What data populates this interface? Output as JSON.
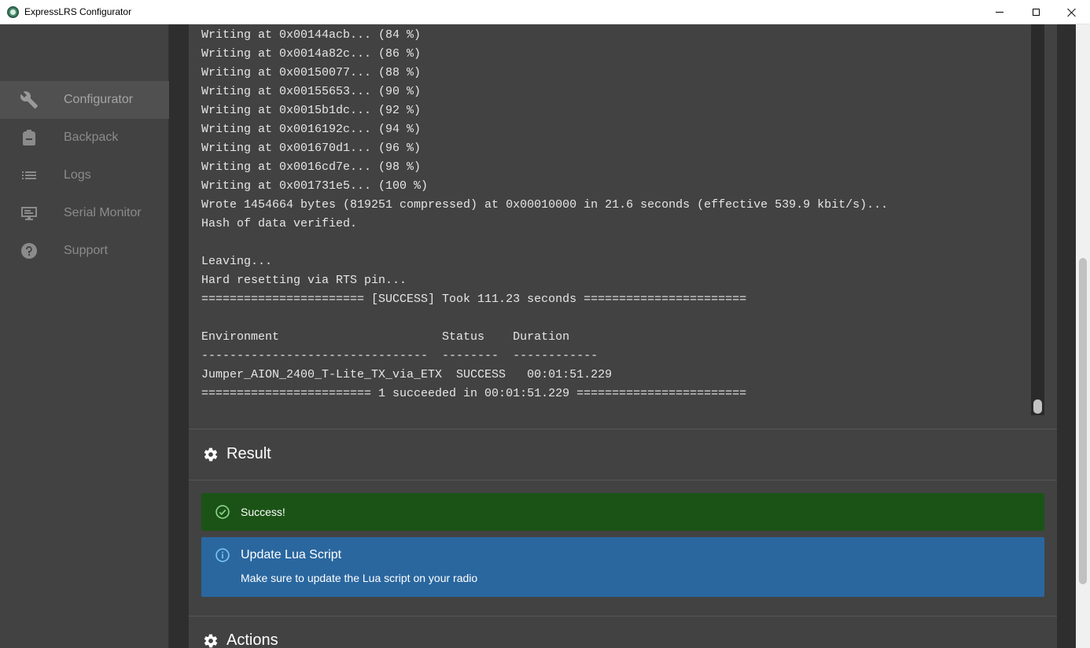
{
  "window": {
    "title": "ExpressLRS Configurator",
    "icon": "expresslrs-logo-icon",
    "controls": [
      "minimize-icon",
      "maximize-icon",
      "close-icon"
    ]
  },
  "sidebar": {
    "active": "Configurator",
    "items": [
      {
        "label": "Configurator",
        "icon": "wrench-icon"
      },
      {
        "label": "Backpack",
        "icon": "backpack-icon"
      },
      {
        "label": "Logs",
        "icon": "list-icon"
      },
      {
        "label": "Serial Monitor",
        "icon": "monitor-icon"
      },
      {
        "label": "Support",
        "icon": "help-circle-icon"
      }
    ]
  },
  "terminal": {
    "lines": [
      "Writing at 0x00144acb... (84 %)",
      "Writing at 0x0014a82c... (86 %)",
      "Writing at 0x00150077... (88 %)",
      "Writing at 0x00155653... (90 %)",
      "Writing at 0x0015b1dc... (92 %)",
      "Writing at 0x0016192c... (94 %)",
      "Writing at 0x001670d1... (96 %)",
      "Writing at 0x0016cd7e... (98 %)",
      "Writing at 0x001731e5... (100 %)",
      "Wrote 1454664 bytes (819251 compressed) at 0x00010000 in 21.6 seconds (effective 539.9 kbit/s)...",
      "Hash of data verified.",
      "",
      "Leaving...",
      "Hard resetting via RTS pin...",
      "======================= [SUCCESS] Took 111.23 seconds =======================",
      "",
      "Environment                       Status    Duration",
      "--------------------------------  --------  ------------",
      "Jumper_AION_2400_T-Lite_TX_via_ETX  SUCCESS   00:01:51.229",
      "======================== 1 succeeded in 00:01:51.229 ========================"
    ]
  },
  "result": {
    "heading": "Result",
    "icon": "gear-icon",
    "success_message": "Success!",
    "success_icon": "check-circle-icon",
    "info_title": "Update Lua Script",
    "info_text": "Make sure to update the Lua script on your radio",
    "info_icon": "info-circle-icon"
  },
  "actions": {
    "heading": "Actions",
    "icon": "gear-icon"
  },
  "colors": {
    "success": "#1b5317",
    "info": "#2a679f",
    "sidebar": "#424242",
    "panel": "#424242"
  }
}
